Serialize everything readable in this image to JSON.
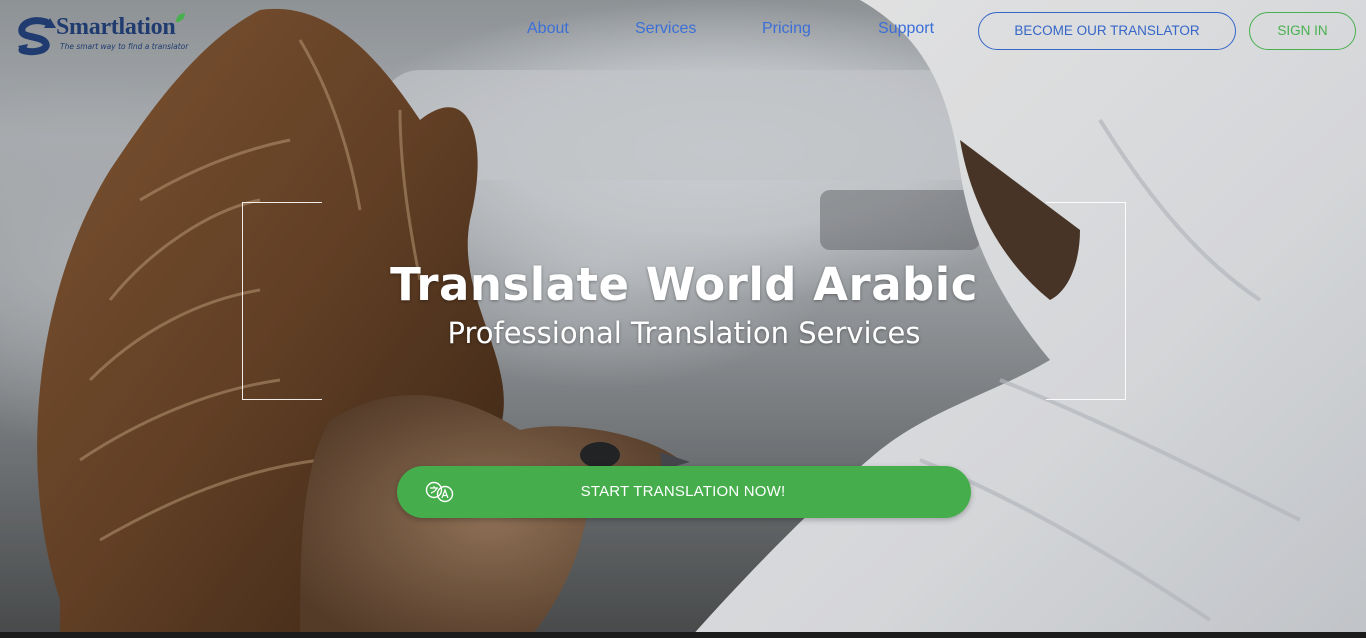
{
  "logo": {
    "name": "Smartlation",
    "tagline": "The smart way to find a translator",
    "colors": {
      "primary": "#1f3b6f",
      "accent": "#49b04f"
    }
  },
  "nav": {
    "items": [
      {
        "label": "About"
      },
      {
        "label": "Services"
      },
      {
        "label": "Pricing"
      },
      {
        "label": "Support"
      }
    ],
    "become_translator": "BECOME OUR TRANSLATOR",
    "sign_in": "SIGN IN"
  },
  "hero": {
    "title": "Translate World Arabic",
    "subtitle": "Professional Translation Services",
    "cta": {
      "label": "START TRANSLATION NOW!",
      "icon": "translate-icon"
    }
  },
  "colors": {
    "nav_link": "#3b6fd8",
    "outline_blue": "#3566c8",
    "green": "#46ad4c"
  }
}
